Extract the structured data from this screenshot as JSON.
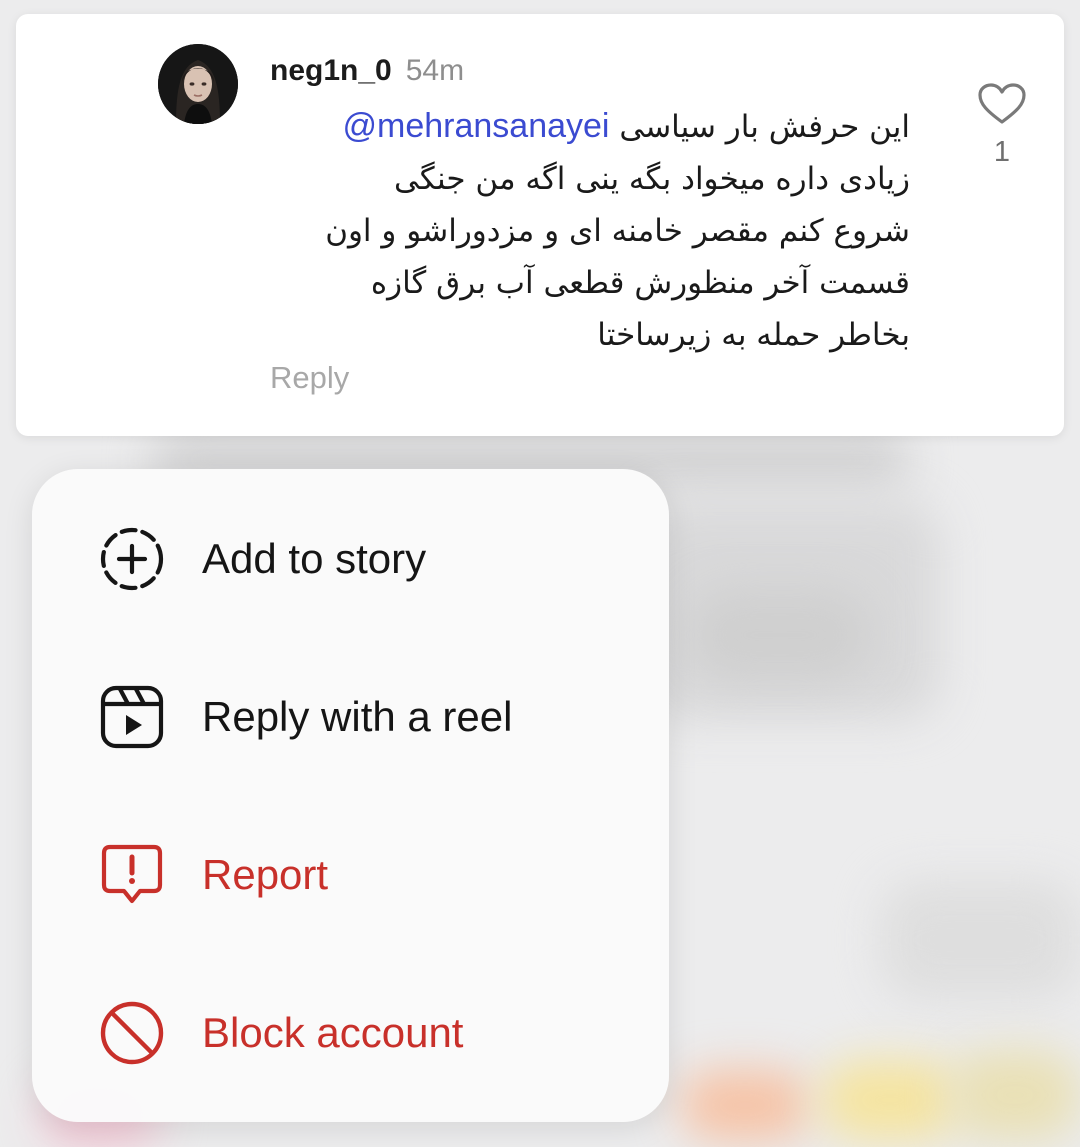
{
  "comment": {
    "username": "neg1n_0",
    "time": "54m",
    "mention": "@mehransanayei",
    "lines": [
      "این حرفش بار سیاسی",
      "زیادی داره میخواد بگه ینی اگه من جنگی",
      "شروع کنم مقصر خامنه ای و مزدوراشو و اون",
      "قسمت آخر منظورش قطعی آب برق گازه",
      "بخاطر حمله به زیرساختا"
    ],
    "reply_label": "Reply",
    "like_count": "1",
    "avatar_icon": "profile-photo"
  },
  "menu": {
    "items": [
      {
        "label": "Add to story",
        "icon": "add-story-icon",
        "color": "#151515"
      },
      {
        "label": "Reply with a reel",
        "icon": "reel-icon",
        "color": "#151515"
      },
      {
        "label": "Report",
        "icon": "report-icon",
        "color": "#c8302a"
      },
      {
        "label": "Block account",
        "icon": "block-icon",
        "color": "#c8302a"
      }
    ]
  },
  "colors": {
    "mention": "#3b4bd1",
    "danger": "#c8302a",
    "muted": "#8e8e8e"
  }
}
